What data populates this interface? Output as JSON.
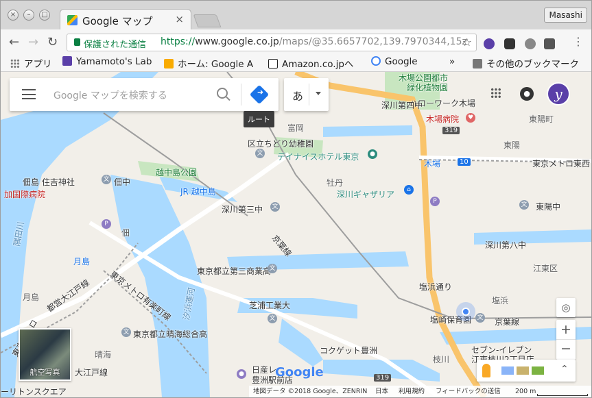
{
  "browser": {
    "tab_title": "Google マップ",
    "tab_close": "×",
    "profile_name": "Masashi",
    "secure_label": "保護された通信",
    "url_protocol": "https://",
    "url_host": "www.google.co.jp",
    "url_path": "/maps/@35.6657702,139.7970344,15z",
    "bookmarks": [
      {
        "label": "アプリ",
        "color": "#777777"
      },
      {
        "label": "Yamamoto's Lab",
        "color": "#5a3fa8"
      },
      {
        "label": "ホーム: Google A",
        "color": "#f9ab00"
      },
      {
        "label": "Amazon.co.jpへ",
        "color": "#222222"
      },
      {
        "label": "Google",
        "color": "#4285f4"
      }
    ],
    "bookmarks_overflow": "»",
    "other_bookmarks": "その他のブックマーク"
  },
  "maps": {
    "search_placeholder": "Google マップを検索する",
    "directions_tooltip": "ルート",
    "ime_char": "あ",
    "logo": "Google",
    "satellite_label": "航空写真",
    "zoom_in": "+",
    "zoom_out": "−",
    "footer": {
      "map_data": "地図データ ©2018 Google、ZENRIN",
      "country": "日本",
      "terms": "利用規約",
      "feedback": "フィードバックの送信",
      "scale": "200 m"
    },
    "colors": {
      "water": "#aadaff",
      "park": "#c8e6c0",
      "major_road": "#f9c46b",
      "land": "#f2efe9"
    },
    "labels": [
      {
        "text": "木場公園都市",
        "cls": "green"
      },
      {
        "text": "緑化植物園",
        "cls": "green"
      },
      {
        "text": "ハローワーク木場",
        "cls": "dark"
      },
      {
        "text": "木場病院",
        "cls": "red"
      },
      {
        "text": "区立ちどり幼稚園",
        "cls": "dark"
      },
      {
        "text": "デイナイスホテル東京",
        "cls": "teal"
      },
      {
        "text": "富岡",
        "cls": ""
      },
      {
        "text": "越中島公園",
        "cls": "green"
      },
      {
        "text": "JR 越中島",
        "cls": "blue"
      },
      {
        "text": "牡丹",
        "cls": ""
      },
      {
        "text": "深川ギャザリア",
        "cls": "teal"
      },
      {
        "text": "木場",
        "cls": "blue"
      },
      {
        "text": "東陽",
        "cls": ""
      },
      {
        "text": "東京メトロ東西",
        "cls": "dark"
      },
      {
        "text": "佃島 住吉神社",
        "cls": "dark"
      },
      {
        "text": "佃中",
        "cls": "dark"
      },
      {
        "text": "加国際病院",
        "cls": "red"
      },
      {
        "text": "深川第三中",
        "cls": "dark"
      },
      {
        "text": "東陽中",
        "cls": "dark"
      },
      {
        "text": "佃",
        "cls": ""
      },
      {
        "text": "隅田川",
        "cls": "water"
      },
      {
        "text": "京葉線",
        "cls": "dark"
      },
      {
        "text": "深川第八中",
        "cls": "dark"
      },
      {
        "text": "月島",
        "cls": "blue"
      },
      {
        "text": "東京都立第三商業高",
        "cls": "dark"
      },
      {
        "text": "都営大江戸線",
        "cls": "dark"
      },
      {
        "text": "東京メトロ有楽町線",
        "cls": "dark"
      },
      {
        "text": "汐浜運河",
        "cls": "water"
      },
      {
        "text": "塩浜通り",
        "cls": "dark"
      },
      {
        "text": "月島",
        "cls": ""
      },
      {
        "text": "芝浦工業大",
        "cls": "dark"
      },
      {
        "text": "塩浜",
        "cls": ""
      },
      {
        "text": "塩崎保育園",
        "cls": "dark"
      },
      {
        "text": "京葉線",
        "cls": "dark"
      },
      {
        "text": "東京都立晴海総合高",
        "cls": "dark"
      },
      {
        "text": "晴海",
        "cls": ""
      },
      {
        "text": "コクゲット豊洲",
        "cls": "dark"
      },
      {
        "text": "セブン-イレブン",
        "cls": "dark"
      },
      {
        "text": "江東枝川2丁目店",
        "cls": "dark"
      },
      {
        "text": "日産レ",
        "cls": "dark"
      },
      {
        "text": "豊洲駅前店",
        "cls": "dark"
      },
      {
        "text": "枝川",
        "cls": ""
      },
      {
        "text": "東京メトロ",
        "cls": "dark"
      },
      {
        "text": "大江戸線",
        "cls": "dark"
      },
      {
        "text": "ーリトンスクエア",
        "cls": "dark"
      },
      {
        "text": "江東区",
        "cls": ""
      },
      {
        "text": "深川第四中",
        "cls": "dark"
      },
      {
        "text": "東陽町",
        "cls": ""
      }
    ],
    "road_shields": [
      "10",
      "319",
      "319"
    ]
  }
}
